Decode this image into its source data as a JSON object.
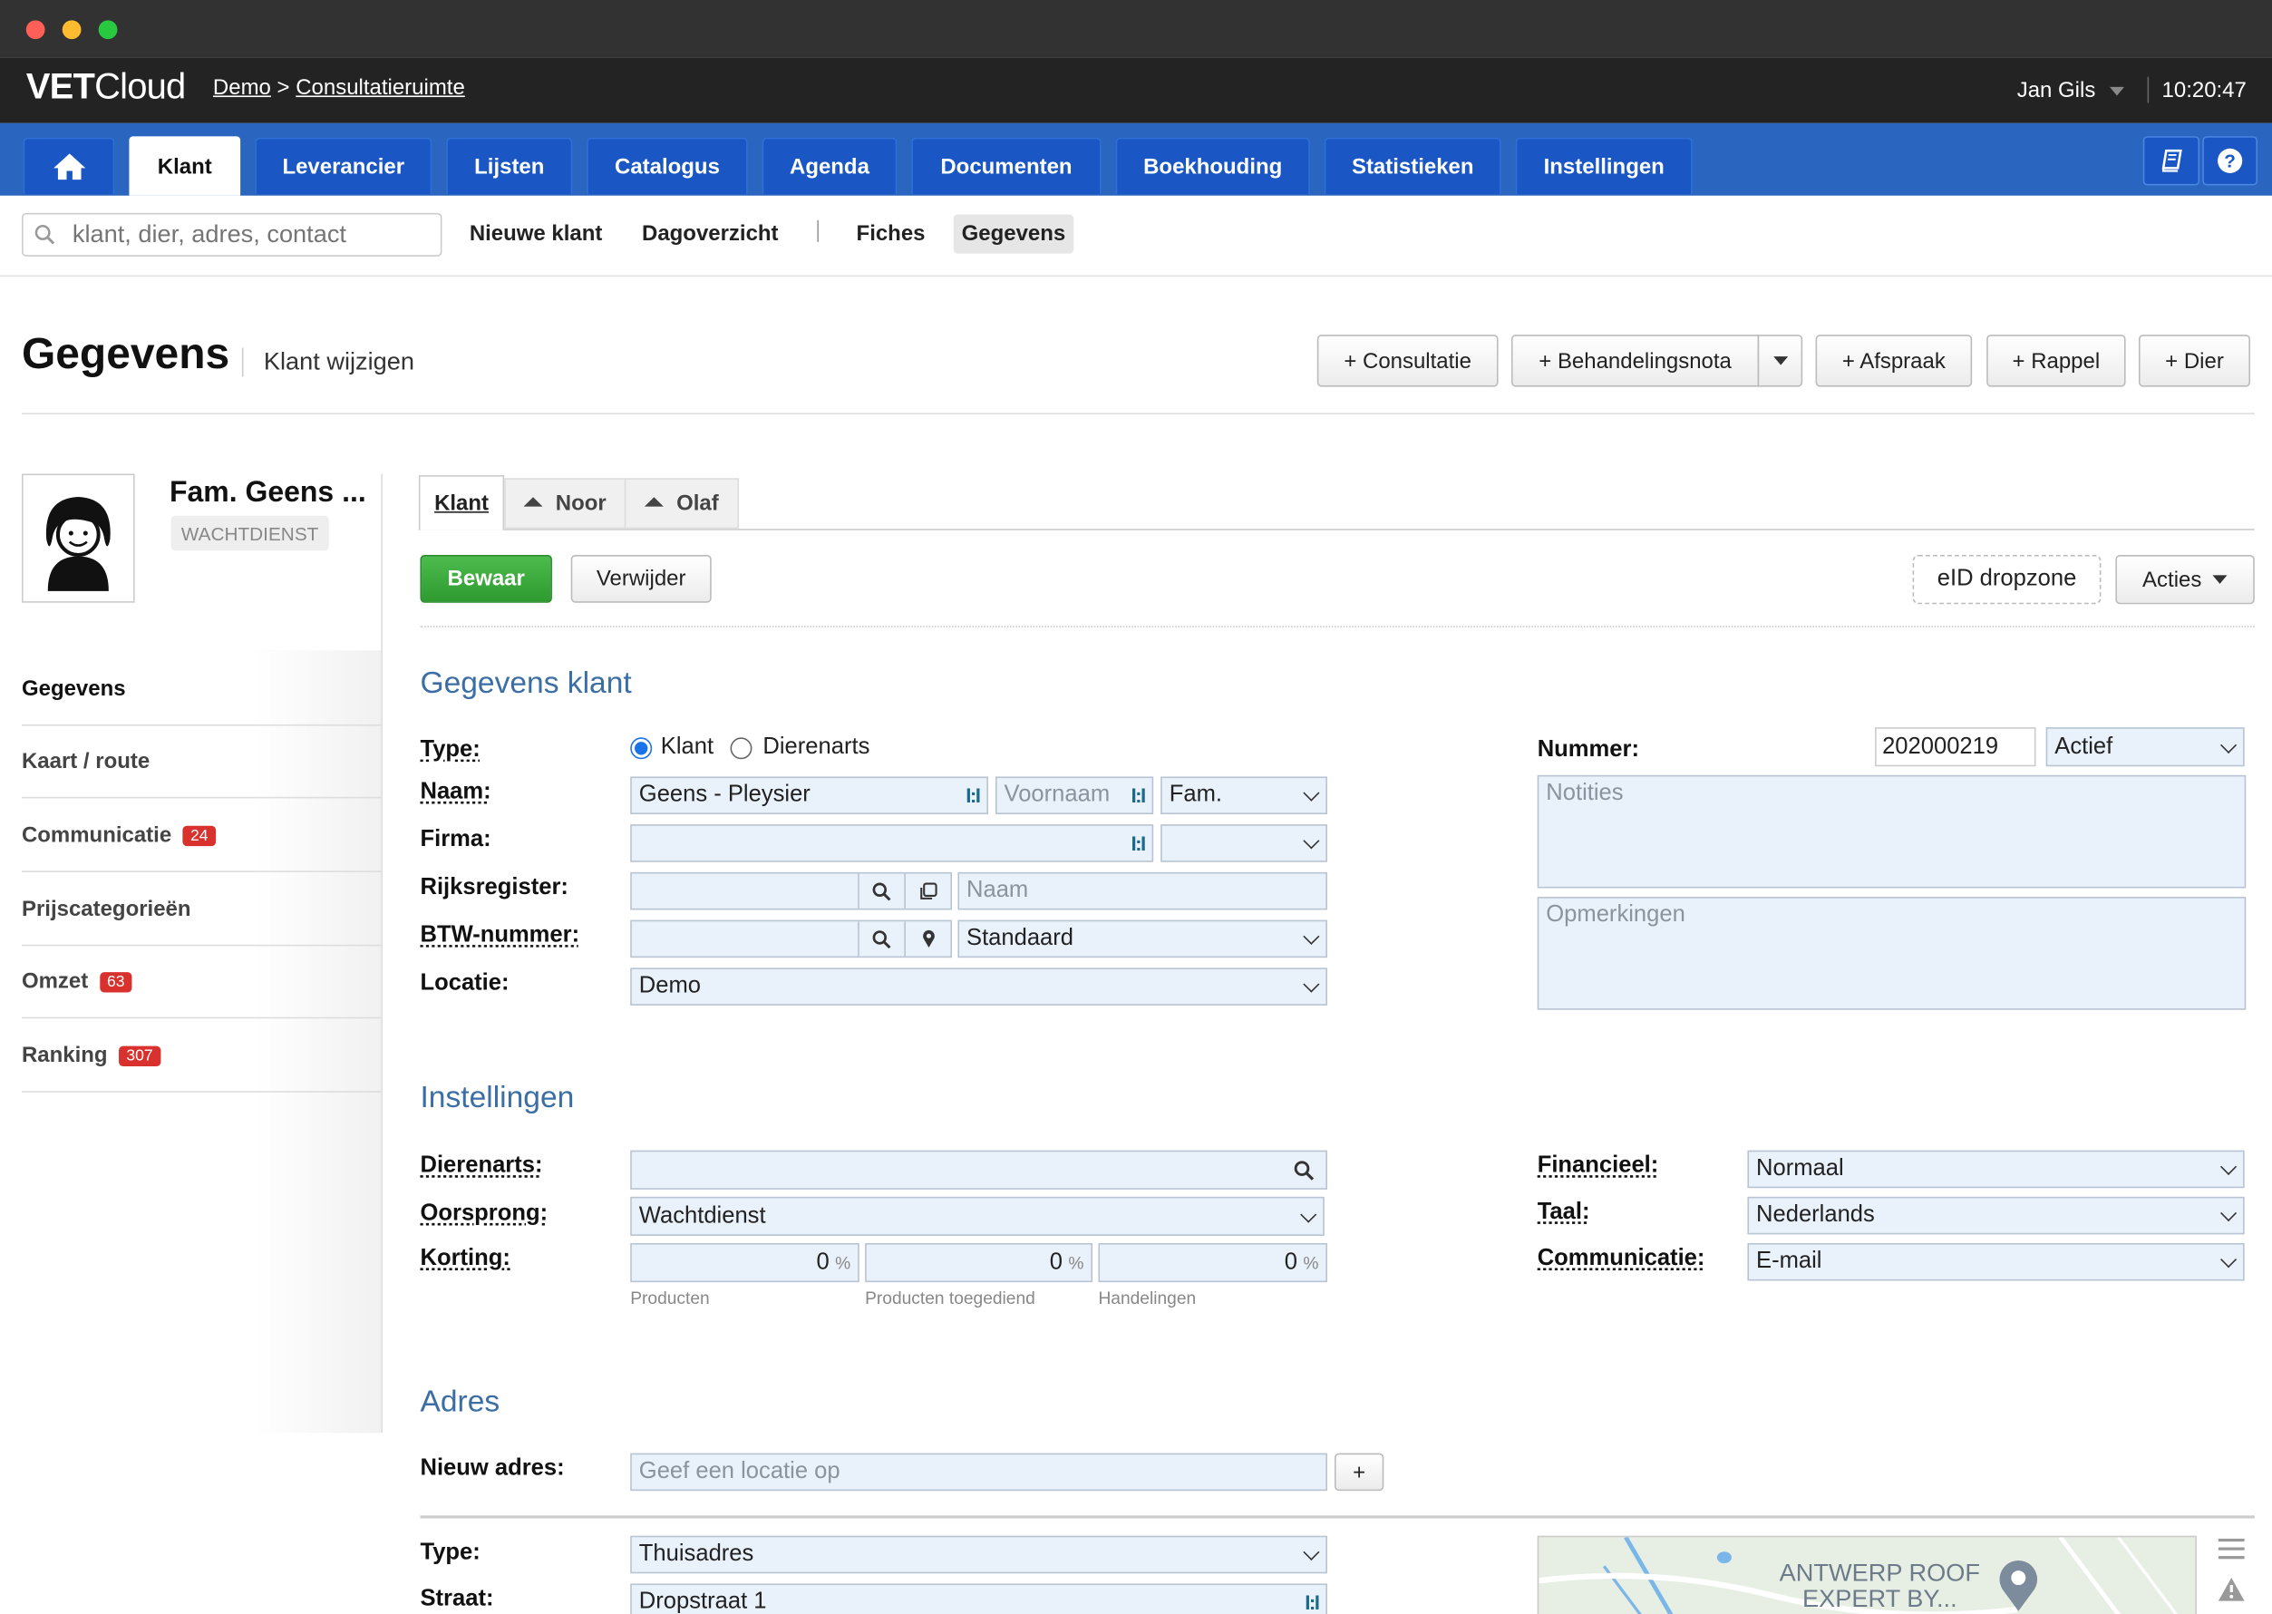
{
  "app": {
    "brand_bold": "VET",
    "brand_light": "Cloud",
    "breadcrumb_root": "Demo",
    "breadcrumb_sep": ">",
    "breadcrumb_current": "Consultatieruimte",
    "user": "Jan Gils",
    "time": "10:20:47"
  },
  "nav": {
    "tabs": [
      "Klant",
      "Leverancier",
      "Lijsten",
      "Catalogus",
      "Agenda",
      "Documenten",
      "Boekhouding",
      "Statistieken",
      "Instellingen"
    ],
    "active": "Klant"
  },
  "subnav": {
    "search_placeholder": "klant, dier, adres, contact",
    "links": [
      "Nieuwe klant",
      "Dagoverzicht",
      "Fiches",
      "Gegevens"
    ],
    "active": "Gegevens"
  },
  "page": {
    "title": "Gegevens",
    "subtitle": "Klant wijzigen",
    "actions": [
      "+ Consultatie",
      "+ Behandelingsnota",
      "+ Afspraak",
      "+ Rappel",
      "+ Dier"
    ]
  },
  "client": {
    "name": "Fam. Geens ...",
    "tag": "WACHTDIENST"
  },
  "sidebar": {
    "items": [
      {
        "label": "Gegevens",
        "badge": ""
      },
      {
        "label": "Kaart / route",
        "badge": ""
      },
      {
        "label": "Communicatie",
        "badge": "24"
      },
      {
        "label": "Prijscategorieën",
        "badge": ""
      },
      {
        "label": "Omzet",
        "badge": "63"
      },
      {
        "label": "Ranking",
        "badge": "307"
      }
    ]
  },
  "record_tabs": [
    "Klant",
    "Noor",
    "Olaf"
  ],
  "toolbar": {
    "save": "Bewaar",
    "delete": "Verwijder",
    "eid": "eID dropzone",
    "actions": "Acties"
  },
  "form": {
    "section_client": "Gegevens klant",
    "type_label": "Type:",
    "type_options": [
      "Klant",
      "Dierenarts"
    ],
    "type_selected": "Klant",
    "naam_label": "Naam:",
    "naam_value": "Geens -  Pleysier",
    "voornaam_placeholder": "Voornaam",
    "aanspreking": "Fam.",
    "firma_label": "Firma:",
    "rijks_label": "Rijksregister:",
    "rijks_naam_placeholder": "Naam",
    "btw_label": "BTW-nummer:",
    "btw_type": "Standaard",
    "locatie_label": "Locatie:",
    "locatie_value": "Demo",
    "nummer_label": "Nummer:",
    "nummer_value": "202000219",
    "status": "Actief",
    "notities_placeholder": "Notities",
    "opmerkingen_placeholder": "Opmerkingen",
    "section_settings": "Instellingen",
    "dierenarts_label": "Dierenarts:",
    "oorsprong_label": "Oorsprong:",
    "oorsprong_value": "Wachtdienst",
    "korting_label": "Korting:",
    "korting": [
      {
        "value": "0",
        "unit": "%",
        "caption": "Producten"
      },
      {
        "value": "0",
        "unit": "%",
        "caption": "Producten toegediend"
      },
      {
        "value": "0",
        "unit": "%",
        "caption": "Handelingen"
      }
    ],
    "financieel_label": "Financieel:",
    "financieel_value": "Normaal",
    "taal_label": "Taal:",
    "taal_value": "Nederlands",
    "communicatie_label": "Communicatie:",
    "communicatie_value": "E-mail",
    "section_address": "Adres",
    "nieuw_adres_label": "Nieuw adres:",
    "nieuw_adres_placeholder": "Geef een locatie op",
    "add_button": "+",
    "adres_type_label": "Type:",
    "adres_type_value": "Thuisadres",
    "straat_label": "Straat:",
    "straat_value": "Dropstraat 1",
    "map_label_line1": "ANTWERP ROOF",
    "map_label_line2": "EXPERT BY..."
  }
}
